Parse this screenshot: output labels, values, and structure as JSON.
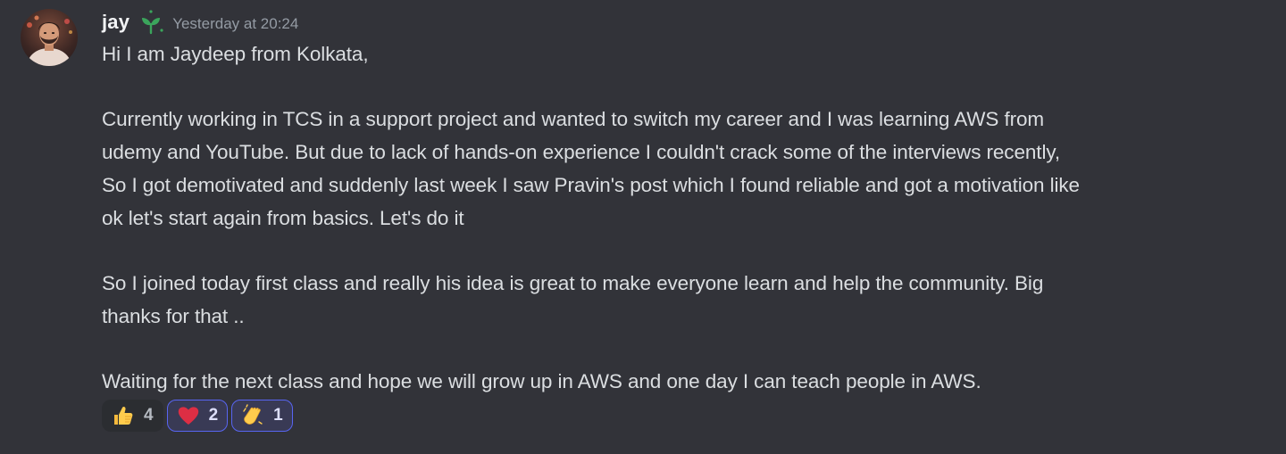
{
  "message": {
    "author": "jay",
    "timestamp": "Yesterday at 20:24",
    "content": "Hi I am Jaydeep from Kolkata,\n\nCurrently working in TCS in a support project and wanted to switch my career and I was learning AWS from\nudemy and YouTube. But due to lack of hands-on experience I couldn't crack some of the interviews recently,\nSo I got demotivated and suddenly last week I saw Pravin's post which I found reliable and got a motivation like\nok let's start again from basics. Let's do it\n\nSo I joined today first class and really his idea is great to make everyone learn and help the community. Big\nthanks for that ..\n\nWaiting for the next class and hope we will grow up in AWS and one day I can teach people in AWS.",
    "role_icon": "sprout-icon",
    "role_color": "#3ba55c"
  },
  "reactions": [
    {
      "emoji": "thumbs-up-icon",
      "count": "4",
      "me": false
    },
    {
      "emoji": "red-heart-icon",
      "count": "2",
      "me": true
    },
    {
      "emoji": "clapping-hands-icon",
      "count": "1",
      "me": true
    }
  ],
  "colors": {
    "background": "#323339",
    "text": "#dbdee1",
    "username": "#f2f3f5",
    "timestamp": "#949ba4",
    "reaction_me_border": "#5865f2"
  }
}
